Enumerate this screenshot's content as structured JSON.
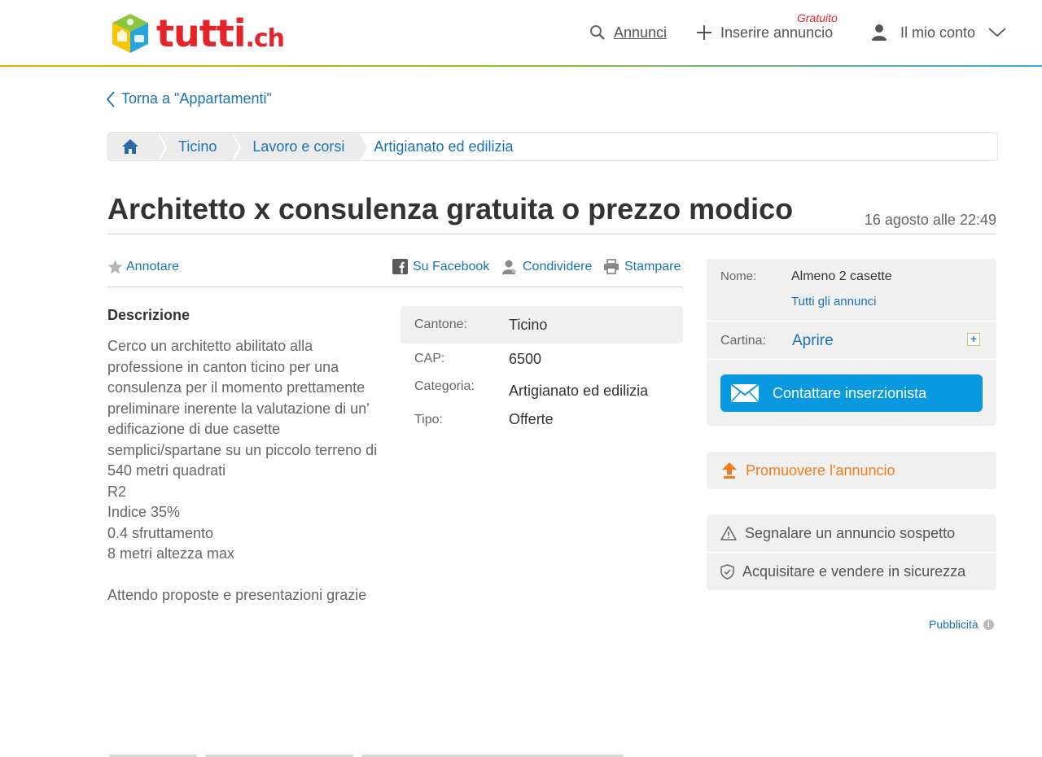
{
  "header": {
    "logo_text": "tutti",
    "logo_suffix": ".ch",
    "nav_search": "Annunci",
    "nav_insert": "Inserire annuncio",
    "insert_badge": "Gratuito",
    "nav_account": "Il mio conto"
  },
  "back_link": "Torna a \"Appartamenti\"",
  "breadcrumb": [
    "Ticino",
    "Lavoro e corsi",
    "Artigianato ed edilizia"
  ],
  "ad": {
    "title": "Architetto x consulenza gratuita o prezzo modico",
    "date": "16 agosto alle 22:49"
  },
  "actions": {
    "note": "Annotare",
    "facebook": "Su Facebook",
    "share": "Condividere",
    "print": "Stampare"
  },
  "description": {
    "heading": "Descrizione",
    "text": "Cerco un architetto abilitato alla professione in canton ticino per una consulenza per il momento prettamente preliminare inerente la valutazione di un' edificazione di due casette semplici/spartane su un piccolo terreno di 540 metri quadrati\nR2\nIndice 35%\n0.4 sfruttamento\n8 metri altezza max\n\nAttendo proposte e presentazioni grazie"
  },
  "details": [
    {
      "key": "Cantone:",
      "value": "Ticino"
    },
    {
      "key": "CAP:",
      "value": "6500"
    },
    {
      "key": "Categoria:",
      "value": "Artigianato ed edilizia"
    },
    {
      "key": "Tipo:",
      "value": "Offerte"
    }
  ],
  "seller": {
    "name_label": "Nome:",
    "name_value": "Almeno 2 casette",
    "all_ads": "Tutti gli annunci",
    "map_label": "Cartina:",
    "map_open": "Aprire",
    "contact": "Contattare inserzionista"
  },
  "promote": "Promuovere l'annuncio",
  "safety": {
    "report": "Segnalare un annuncio sospetto",
    "safe_trade": "Acquisitare e vendere in sicurezza"
  },
  "advertising": "Pubblicità",
  "colors": {
    "brand_red": "#e3242b",
    "link_blue": "#1a73b5",
    "button_blue": "#0899e0",
    "promote_orange": "#f07d1b"
  }
}
